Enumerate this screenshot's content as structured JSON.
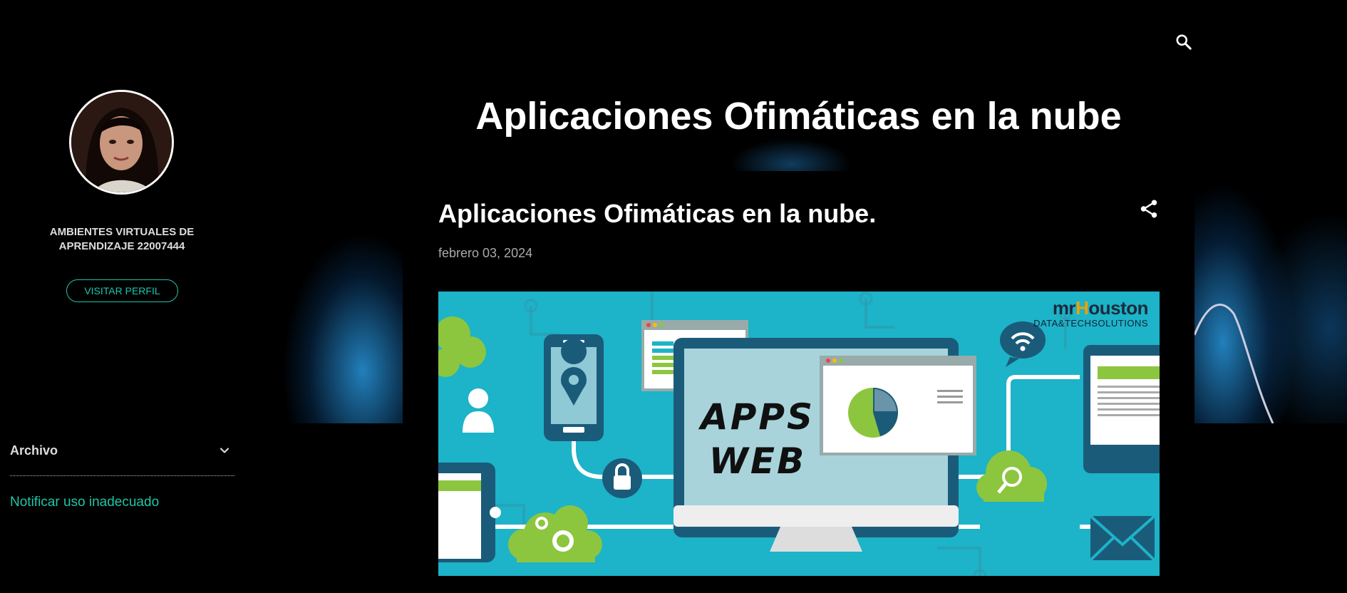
{
  "blog": {
    "title": "Aplicaciones Ofimáticas en la nube"
  },
  "sidebar": {
    "profile_name": "AMBIENTES VIRTUALES DE APRENDIZAJE 22007444",
    "visit_profile_label": "VISITAR PERFIL",
    "archive_label": "Archivo",
    "report_link": "Notificar uso inadecuado"
  },
  "post": {
    "title": "Aplicaciones Ofimáticas en la nube.",
    "date": "febrero 03, 2024",
    "image": {
      "brand_prefix": "mr",
      "brand_highlight": "H",
      "brand_suffix": "ouston",
      "brand_tagline": "DATA&TECHSOLUTIONS",
      "headline_line1": "APPS",
      "headline_line2": "WEB"
    }
  },
  "icons": {
    "search": "search-icon",
    "share": "share-icon",
    "archive_toggle": "chevron-down-icon"
  },
  "colors": {
    "background": "#000000",
    "accent": "#1fc5a8",
    "text": "#ffffff",
    "muted": "#aaaaaa",
    "image_bg": "#1db3c8"
  }
}
